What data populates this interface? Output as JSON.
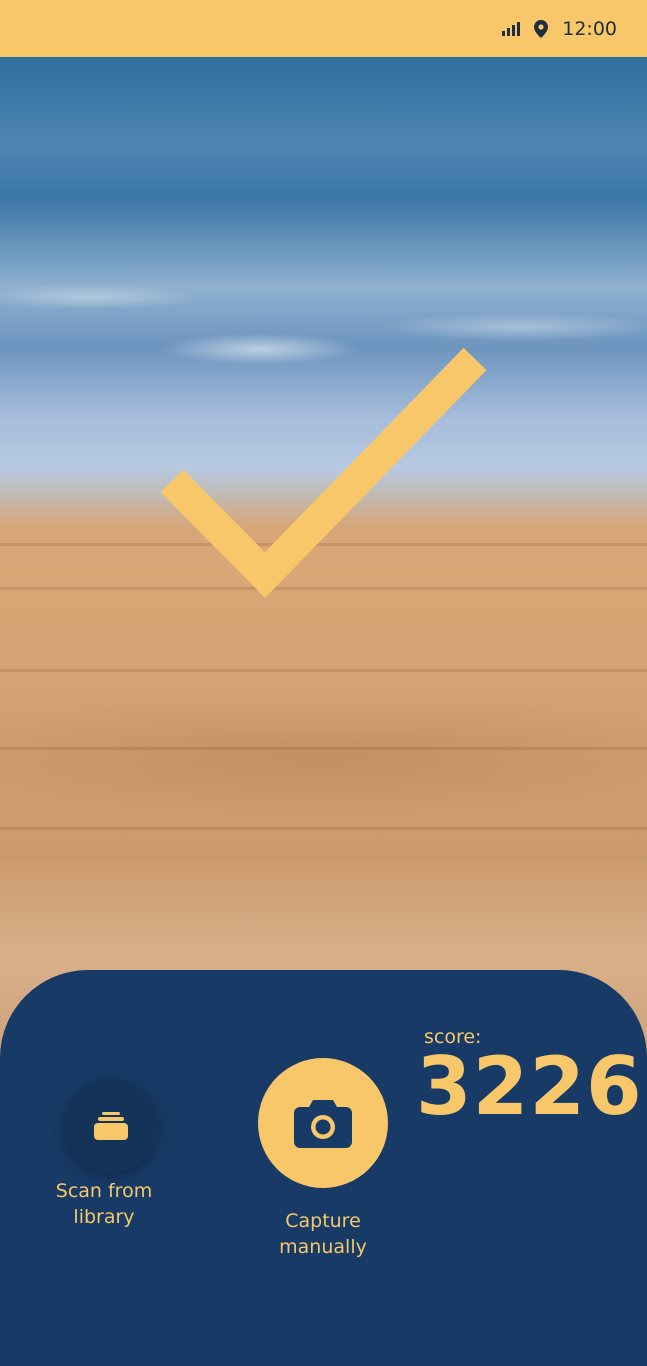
{
  "status_bar": {
    "time": "12:00",
    "icons": [
      "signal-icon",
      "location-pin-icon"
    ]
  },
  "background": {
    "description_icon": "beach-photo"
  },
  "overlay": {
    "icon": "checkmark-icon"
  },
  "score": {
    "label": "score:",
    "value": "3226"
  },
  "actions": {
    "library": {
      "label": "Scan from library",
      "icon": "library-stack-icon"
    },
    "capture": {
      "label": "Capture manually",
      "icon": "camera-icon"
    }
  },
  "colors": {
    "accent": "#f8c76a",
    "panel": "#173a66",
    "panel_button": "#133358",
    "status_text": "#1f2d3d"
  }
}
